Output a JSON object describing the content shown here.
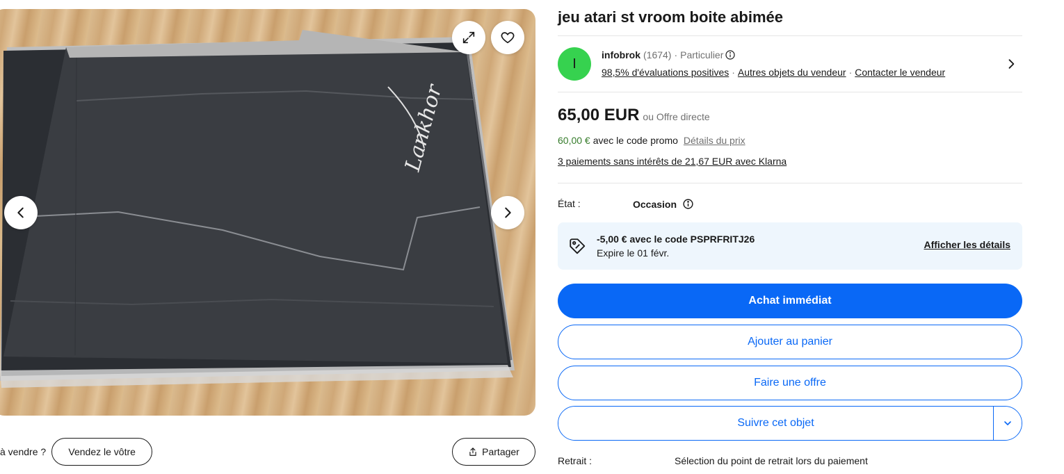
{
  "gallery": {
    "image_alt_brand": "Lankhor",
    "expand_icon": "expand-icon",
    "favorite_icon": "heart-icon",
    "prev_icon": "chevron-left-icon",
    "next_icon": "chevron-right-icon"
  },
  "sell": {
    "prompt": "à vendre ?",
    "button_label": "Vendez le vôtre"
  },
  "share": {
    "label": "Partager",
    "icon": "share-icon"
  },
  "listing": {
    "title": "jeu atari st vroom boite abimée"
  },
  "seller": {
    "avatar_letter": "I",
    "avatar_color": "#36d24f",
    "name": "infobrok",
    "rating_count": "(1674)",
    "type": "Particulier",
    "positive_feedback": "98,5% d'évaluations positives",
    "other_items": "Autres objets du vendeur",
    "contact": "Contacter le vendeur"
  },
  "price": {
    "amount": "65,00 EUR",
    "alt": "ou Offre directe",
    "promo_price": "60,00 €",
    "promo_text": "avec le code promo",
    "details_link": "Détails du prix",
    "klarna": "3 paiements sans intérêts de 21,67 EUR avec Klarna"
  },
  "condition": {
    "label": "État :",
    "value": "Occasion"
  },
  "coupon": {
    "line1": "-5,00 € avec le code PSPRFRITJ26",
    "line2": "Expire le 01 févr.",
    "link": "Afficher les détails",
    "background": "#eef6fd"
  },
  "actions": {
    "buy_now": "Achat immédiat",
    "add_to_cart": "Ajouter au panier",
    "make_offer": "Faire une offre",
    "watch": "Suivre cet objet",
    "accent": "#0968f6"
  },
  "pickup": {
    "label": "Retrait :",
    "value": "Sélection du point de retrait lors du paiement"
  }
}
